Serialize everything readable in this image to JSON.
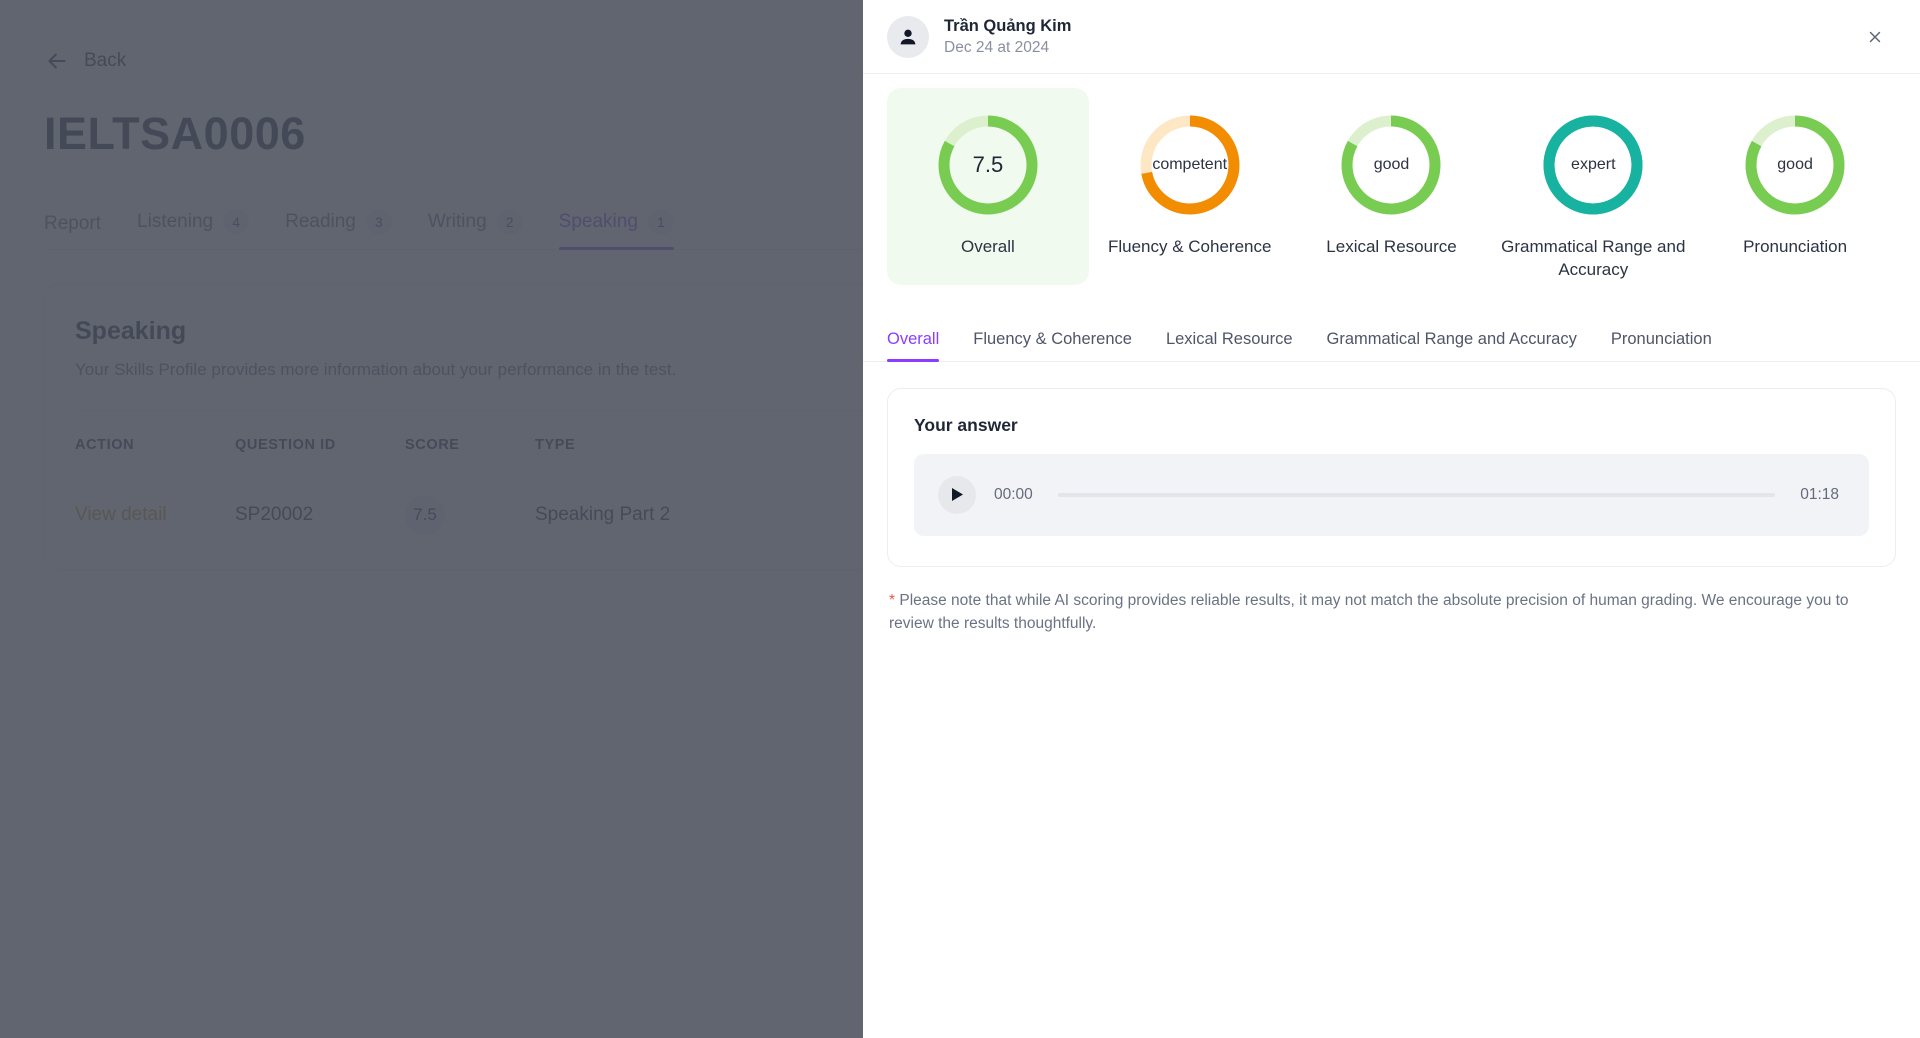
{
  "background": {
    "back_label": "Back",
    "page_title": "IELTSA0006",
    "tabs": [
      {
        "label": "Report",
        "badge": null,
        "active": false
      },
      {
        "label": "Listening",
        "badge": "4",
        "active": false
      },
      {
        "label": "Reading",
        "badge": "3",
        "active": false
      },
      {
        "label": "Writing",
        "badge": "2",
        "active": false
      },
      {
        "label": "Speaking",
        "badge": "1",
        "active": true
      }
    ],
    "section": {
      "title": "Speaking",
      "subtitle": "Your Skills Profile provides more information about your performance in the test.",
      "columns": [
        "ACTION",
        "QUESTION ID",
        "SCORE",
        "TYPE"
      ],
      "rows": [
        {
          "action": "View detail",
          "question_id": "SP20002",
          "score": "7.5",
          "type": "Speaking Part 2"
        }
      ]
    },
    "overlay_color": "#4a505c"
  },
  "drawer": {
    "user_name": "Trần Quảng Kim",
    "user_date": "Dec 24 at 2024",
    "avatar_icon": "person-icon",
    "close_icon": "close-icon",
    "scores": [
      {
        "value": "7.5",
        "label": "Overall",
        "percent": 83,
        "color": "#79cc52",
        "track": "#dcf0cd",
        "highlight": true
      },
      {
        "value": "competent",
        "label": "Fluency & Coherence",
        "percent": 72,
        "color": "#f28c00",
        "track": "#fde7c4",
        "highlight": false
      },
      {
        "value": "good",
        "label": "Lexical Resource",
        "percent": 83,
        "color": "#79cc52",
        "track": "#dcf0cd",
        "highlight": false
      },
      {
        "value": "expert",
        "label": "Grammatical Range and Accuracy",
        "percent": 100,
        "color": "#18b3a0",
        "track": "#18b3a0",
        "highlight": false
      },
      {
        "value": "good",
        "label": "Pronunciation",
        "percent": 83,
        "color": "#79cc52",
        "track": "#dcf0cd",
        "highlight": false
      }
    ],
    "criteria_tabs": [
      {
        "label": "Overall",
        "active": true
      },
      {
        "label": "Fluency & Coherence",
        "active": false
      },
      {
        "label": "Lexical Resource",
        "active": false
      },
      {
        "label": "Grammatical Range and Accuracy",
        "active": false
      },
      {
        "label": "Pronunciation",
        "active": false
      }
    ],
    "answer": {
      "title": "Your answer",
      "play_icon": "play-icon",
      "current_time": "00:00",
      "duration": "01:18",
      "progress_percent": 0
    },
    "note_star": "*",
    "note_text": " Please note that while AI scoring provides reliable results, it may not match the absolute precision of human grading. We encourage you to review the results thoughtfully."
  },
  "colors": {
    "accent_purple": "#8b3dff",
    "green": "#79cc52",
    "orange": "#f28c00",
    "teal": "#18b3a0",
    "action_link": "#c78a16",
    "note_star": "#f0544a"
  }
}
